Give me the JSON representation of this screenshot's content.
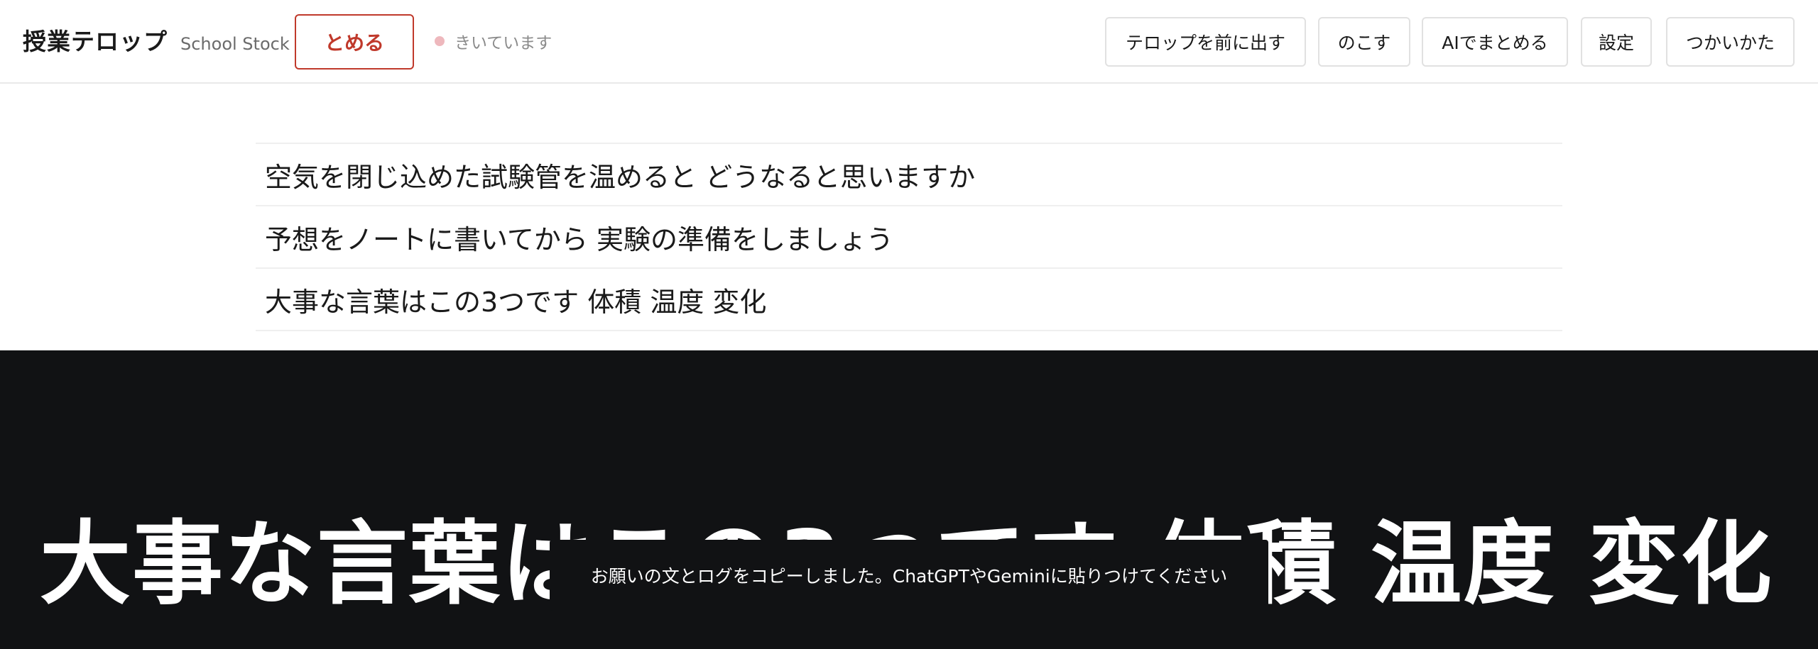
{
  "header": {
    "title": "授業テロップ",
    "subtitle": "School Stock",
    "stop_label": "とめる",
    "status_text": "きいています",
    "toolbar": {
      "bring_front_label": "テロップを前に出す",
      "save_label": "のこす",
      "ai_summary_label": "AIでまとめる",
      "settings_label": "設定",
      "help_label": "つかいかた"
    }
  },
  "colors": {
    "accent": "#c0392b",
    "status_dot": "#eeb8bd",
    "stage_bg": "#111214"
  },
  "transcript": {
    "lines": [
      "空気を閉じ込めた試験管を温めると どうなると思いますか",
      "予想をノートに書いてから 実験の準備をしましょう",
      "大事な言葉はこの3つです 体積 温度 変化"
    ]
  },
  "stage": {
    "caption": "大事な言葉はこの3つです 体積 温度 変化",
    "toast": "お願いの文とログをコピーしました。ChatGPTやGeminiに貼りつけてください"
  }
}
